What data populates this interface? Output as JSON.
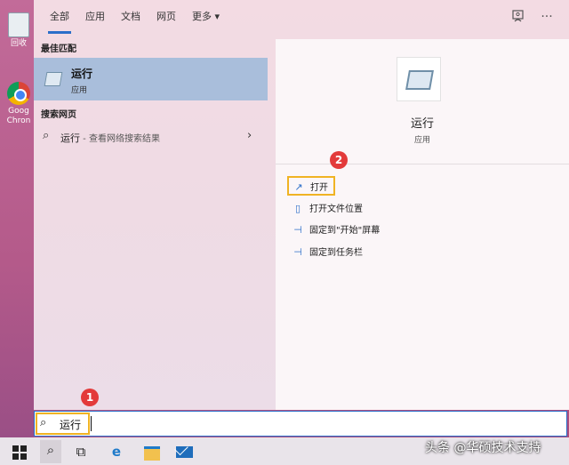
{
  "desktop": {
    "recycle_label": "回收",
    "chrome_label_1": "Goog",
    "chrome_label_2": "Chron"
  },
  "tabs": [
    {
      "label": "全部",
      "active": true
    },
    {
      "label": "应用"
    },
    {
      "label": "文档"
    },
    {
      "label": "网页"
    },
    {
      "label": "更多 ▾"
    }
  ],
  "topbar_icons": [
    "feedback-icon",
    "more-options-icon"
  ],
  "more_glyph": "···",
  "best_match": {
    "title": "最佳匹配",
    "name": "运行",
    "kind": "应用"
  },
  "web_search": {
    "title": "搜索网页",
    "query": "运行",
    "suffix": " - 查看网络搜索结果"
  },
  "detail": {
    "name": "运行",
    "kind": "应用",
    "actions": [
      {
        "label": "打开",
        "icon": "open-icon"
      },
      {
        "label": "打开文件位置",
        "icon": "file-location-icon"
      },
      {
        "label": "固定到\"开始\"屏幕",
        "icon": "pin-icon"
      },
      {
        "label": "固定到任务栏",
        "icon": "pin-icon"
      }
    ]
  },
  "badges": {
    "one": "1",
    "two": "2"
  },
  "search": {
    "value": "运行"
  },
  "watermark": "头条 @华硕技术支持",
  "colors": {
    "accent": "#2b6ec9",
    "highlight": "#f0b323",
    "badge": "#e33a3a"
  }
}
